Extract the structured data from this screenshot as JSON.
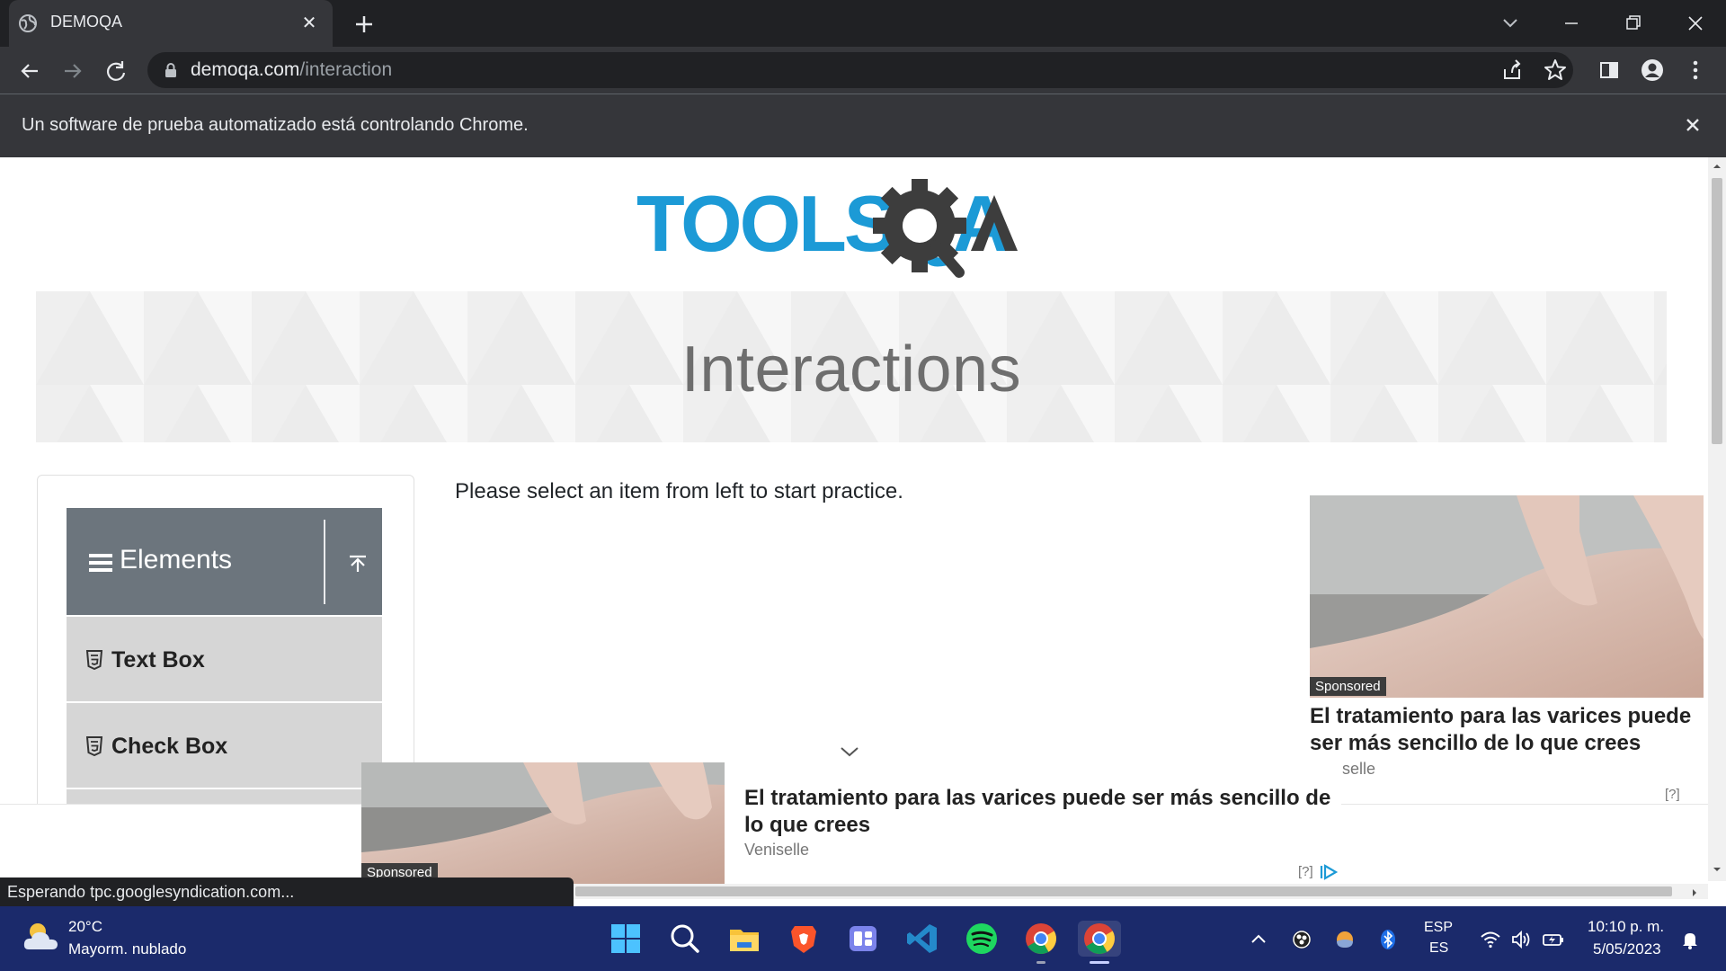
{
  "browser": {
    "tab_title": "DEMOQA",
    "url_host": "demoqa.com",
    "url_path": "/interaction",
    "infobar_text": "Un software de prueba automatizado está controlando Chrome."
  },
  "page": {
    "logo_text": "TOOLSQA",
    "banner_title": "Interactions",
    "practice_text": "Please select an item from left to start practice.",
    "menu": {
      "group_title": "Elements",
      "items": [
        {
          "label": "Text Box"
        },
        {
          "label": "Check Box"
        }
      ]
    }
  },
  "ads": {
    "right": {
      "sponsored": "Sponsored",
      "headline": "El tratamiento para las varices puede ser más sencillo de lo que crees",
      "brand": "selle",
      "info": "[?]"
    },
    "anchor": {
      "sponsored": "Sponsored",
      "headline": "El tratamiento para las varices puede ser más sencillo de lo que crees",
      "brand": "Veniselle",
      "info": "[?]"
    }
  },
  "status_bar": "Esperando tpc.googlesyndication.com...",
  "taskbar": {
    "weather_temp": "20°C",
    "weather_desc": "Mayorm. nublado",
    "lang_1": "ESP",
    "lang_2": "ES",
    "time": "10:10 p. m.",
    "date": "5/05/2023",
    "apps": [
      "start",
      "search",
      "file-explorer",
      "brave",
      "teams-like",
      "vscode",
      "spotify",
      "chrome",
      "chrome"
    ]
  },
  "colors": {
    "chrome_dark": "#202124",
    "chrome_mid": "#35363a",
    "logo_blue": "#1c9ad6",
    "logo_gray": "#3d3d3d",
    "menu_header": "#6c757d",
    "menu_item": "#d6d6d6",
    "taskbar": "#1b2a6b"
  }
}
